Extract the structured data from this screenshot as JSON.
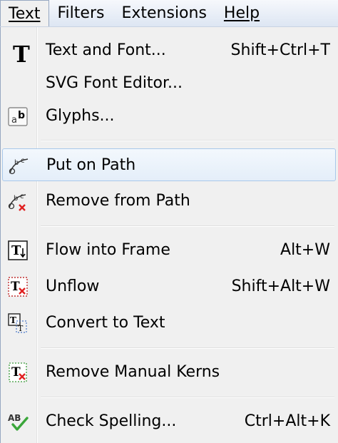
{
  "menubar": {
    "items": [
      {
        "label": "Text",
        "active": true
      },
      {
        "label": "Filters",
        "active": false
      },
      {
        "label": "Extensions",
        "active": false
      },
      {
        "label": "Help",
        "active": false
      }
    ]
  },
  "menu": {
    "items": [
      {
        "label": "Text and Font...",
        "shortcut": "Shift+Ctrl+T",
        "icon": "text-font-icon"
      },
      {
        "label": "SVG Font Editor...",
        "shortcut": "",
        "icon": ""
      },
      {
        "label": "Glyphs...",
        "shortcut": "",
        "icon": "glyphs-icon"
      },
      {
        "label": "Put on Path",
        "shortcut": "",
        "icon": "put-on-path-icon",
        "highlighted": true
      },
      {
        "label": "Remove from Path",
        "shortcut": "",
        "icon": "remove-from-path-icon"
      },
      {
        "label": "Flow into Frame",
        "shortcut": "Alt+W",
        "icon": "flow-into-frame-icon"
      },
      {
        "label": "Unflow",
        "shortcut": "Shift+Alt+W",
        "icon": "unflow-icon"
      },
      {
        "label": "Convert to Text",
        "shortcut": "",
        "icon": "convert-to-text-icon"
      },
      {
        "label": "Remove Manual Kerns",
        "shortcut": "",
        "icon": "remove-kerns-icon"
      },
      {
        "label": "Check Spelling...",
        "shortcut": "Ctrl+Alt+K",
        "icon": "spellcheck-icon"
      }
    ]
  },
  "colors": {
    "highlight_border": "#a8c8ea",
    "remove_red": "#e02020",
    "check_green": "#3aa63a"
  }
}
